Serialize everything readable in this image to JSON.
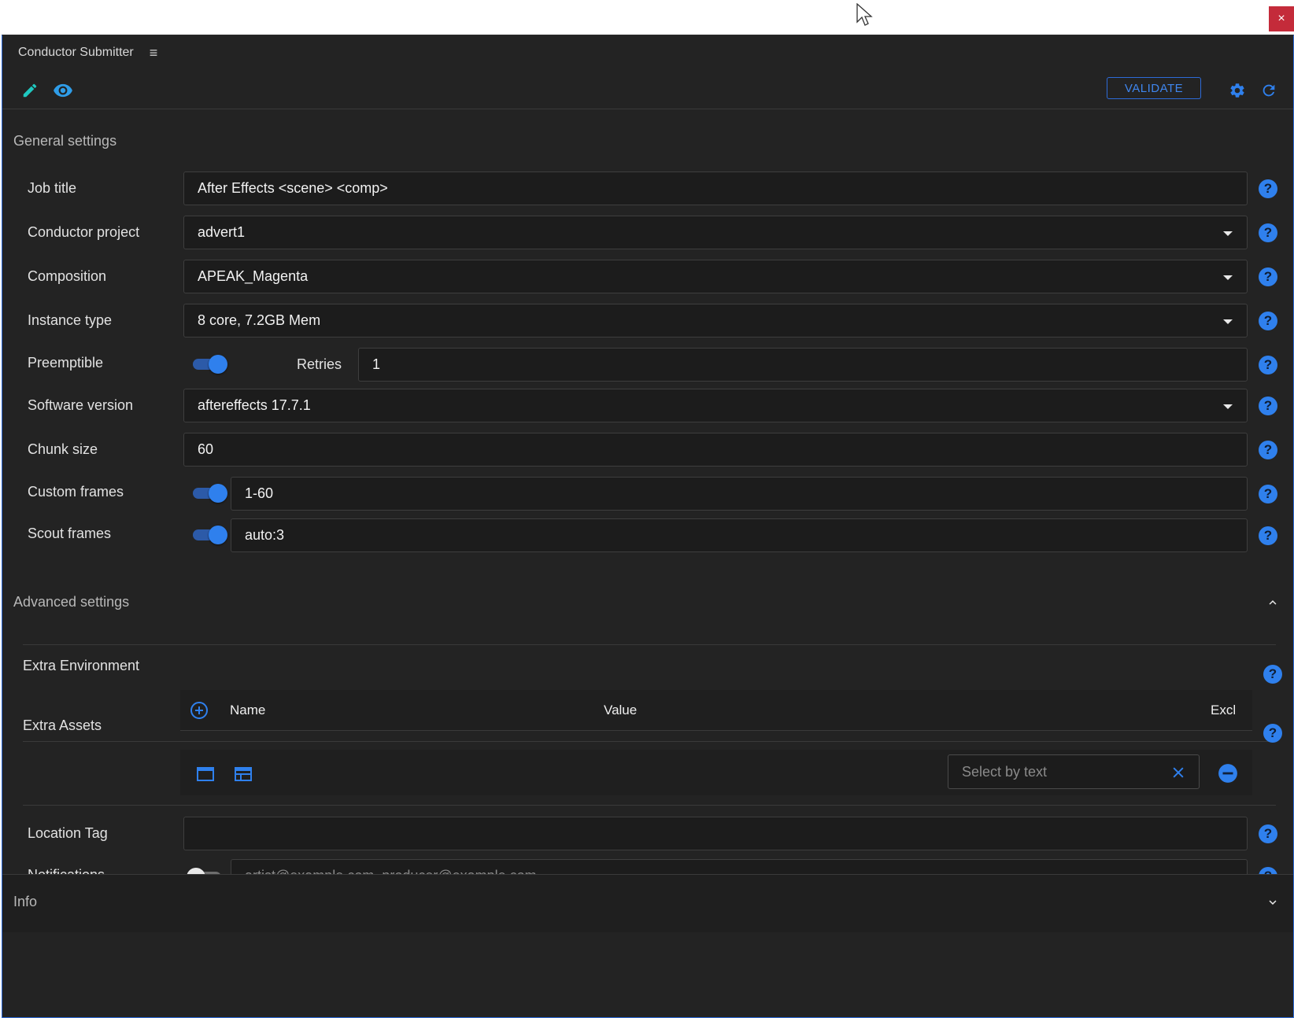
{
  "window": {
    "close_label": "×"
  },
  "app": {
    "title": "Conductor Submitter",
    "menu_icon": "hamburger-icon"
  },
  "toolbar": {
    "edit_icon": "pencil-icon",
    "preview_icon": "eye-icon",
    "validate_label": "VALIDATE",
    "settings_icon": "gear-icon",
    "refresh_icon": "refresh-icon"
  },
  "general": {
    "title": "General settings",
    "job_title": {
      "label": "Job title",
      "value": "After Effects <scene> <comp>"
    },
    "project": {
      "label": "Conductor project",
      "value": "advert1"
    },
    "composition": {
      "label": "Composition",
      "value": "APEAK_Magenta"
    },
    "instance_type": {
      "label": "Instance type",
      "value": "8 core, 7.2GB Mem"
    },
    "preemptible": {
      "label": "Preemptible",
      "enabled": true,
      "retries_label": "Retries",
      "retries_value": "1"
    },
    "software": {
      "label": "Software version",
      "value": "aftereffects 17.7.1"
    },
    "chunk_size": {
      "label": "Chunk size",
      "value": "60"
    },
    "custom_frames": {
      "label": "Custom frames",
      "enabled": true,
      "value": "1-60"
    },
    "scout_frames": {
      "label": "Scout frames",
      "enabled": true,
      "value": "auto:3"
    },
    "help_glyph": "?"
  },
  "advanced": {
    "title": "Advanced settings",
    "extra_env": {
      "label": "Extra Environment",
      "col_name": "Name",
      "col_value": "Value",
      "col_excl": "Excl"
    },
    "extra_assets": {
      "label": "Extra Assets",
      "filter_placeholder": "Select by text"
    },
    "location_tag": {
      "label": "Location Tag",
      "value": ""
    },
    "notifications": {
      "label": "Notifications",
      "enabled": false,
      "placeholder": "artist@example.com, producer@example.com"
    }
  },
  "info": {
    "title": "Info"
  },
  "colors": {
    "accent": "#2f80ed",
    "panel_bg": "#232323",
    "close_red": "#c42b3a"
  }
}
